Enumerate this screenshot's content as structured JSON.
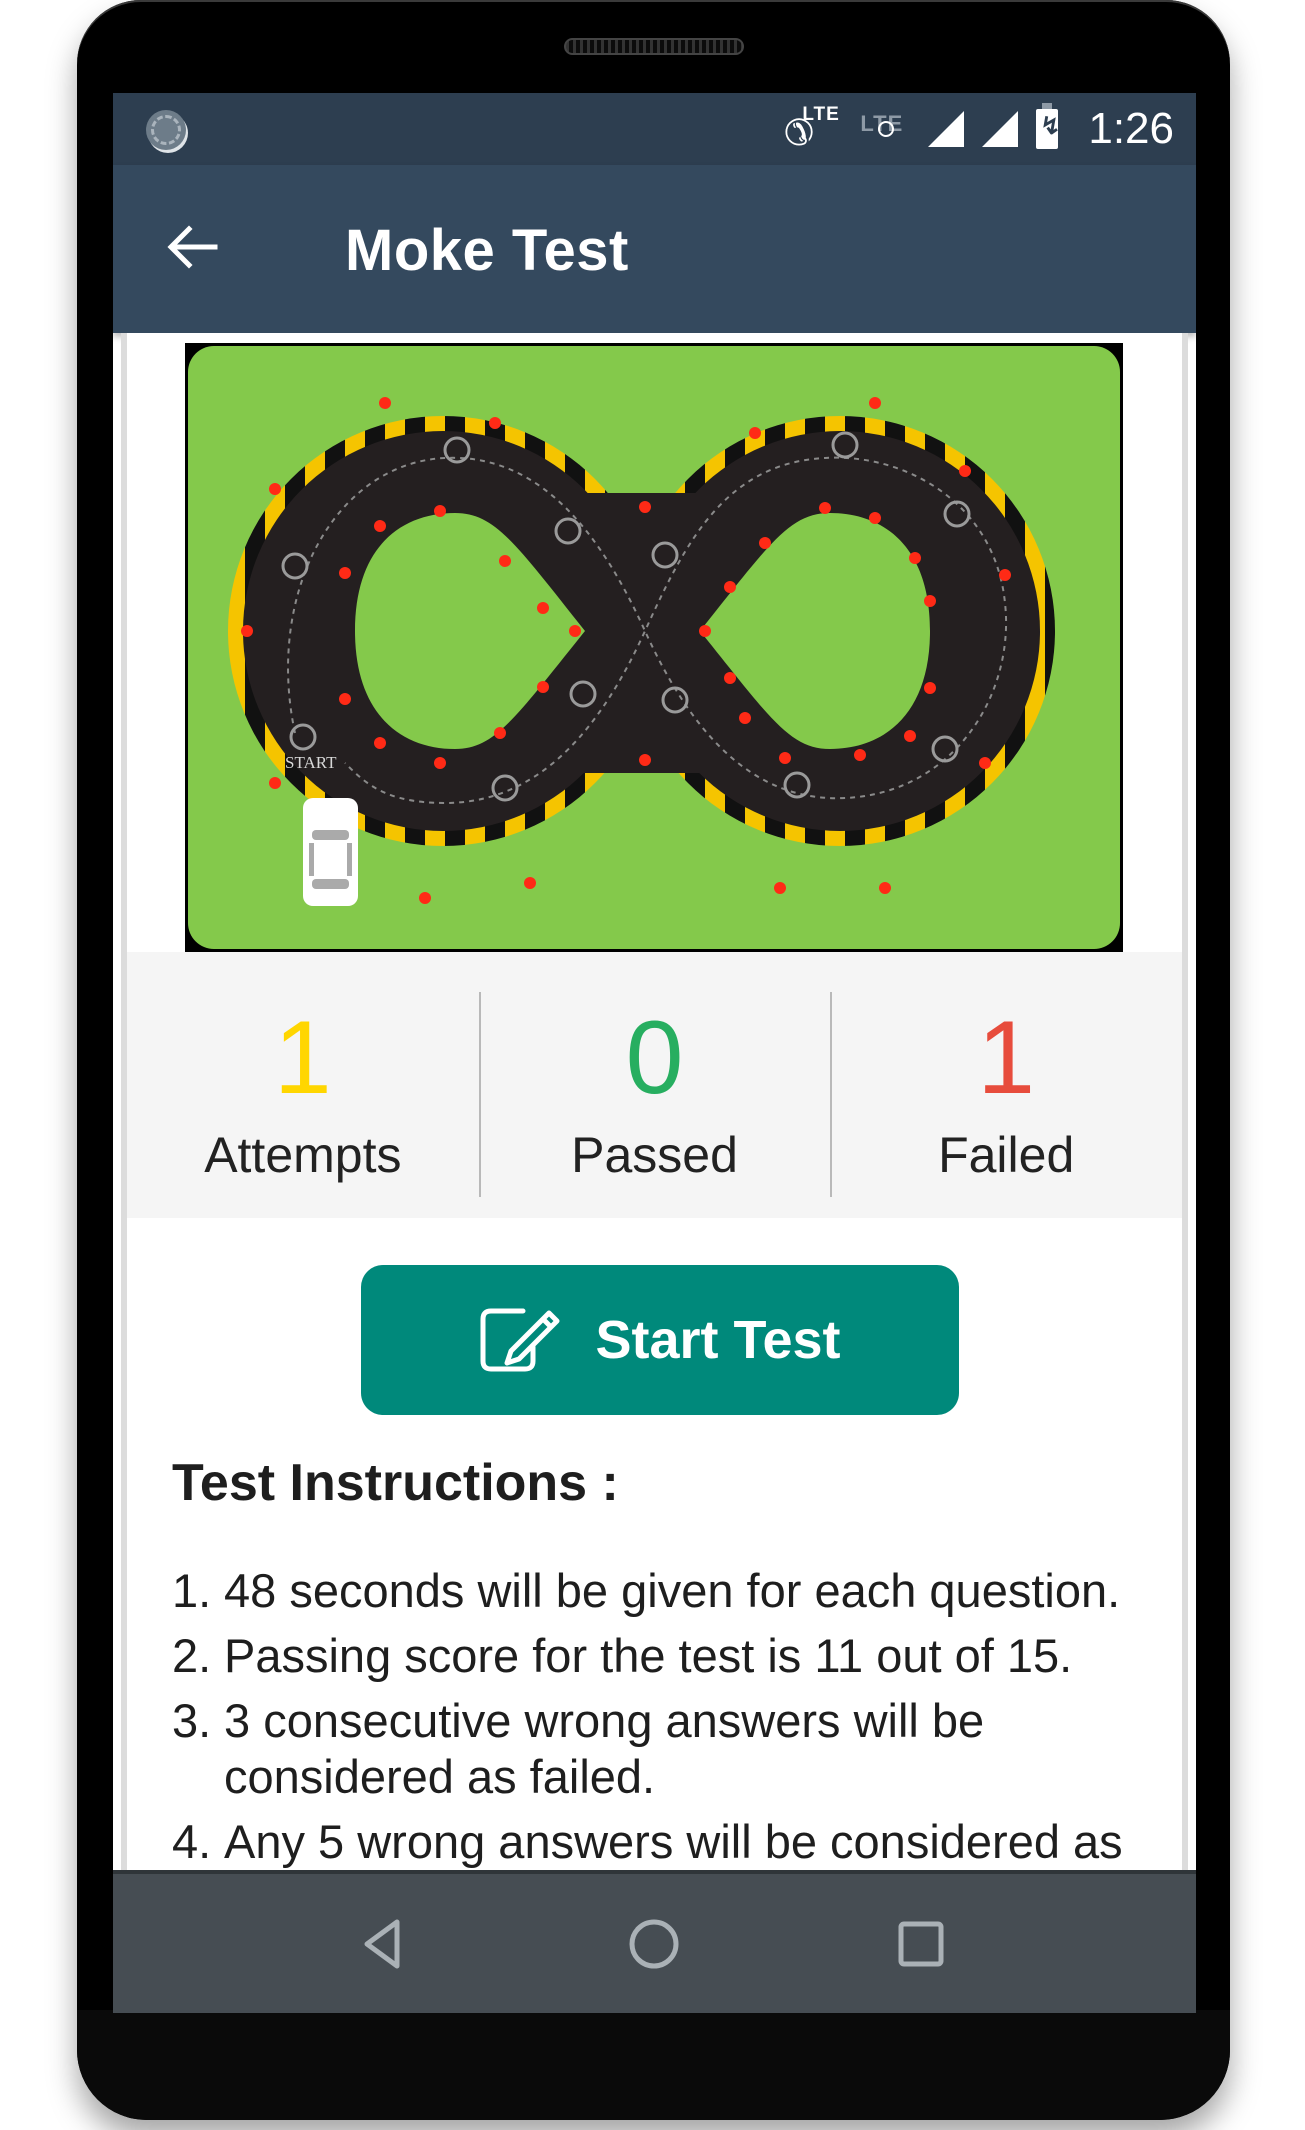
{
  "status_bar": {
    "call_lte_label": "LTE",
    "data_lte_label": "LTE",
    "time": "1:26",
    "icons": [
      "loading-spinner-icon",
      "call-lte-icon",
      "lte-disabled-icon",
      "signal-icon",
      "signal-icon",
      "battery-charging-icon"
    ]
  },
  "app_bar": {
    "back_icon": "arrow-left-icon",
    "title": "Moke Test"
  },
  "track_image": {
    "description": "Figure-eight driving test track",
    "start_label": "START"
  },
  "stats": [
    {
      "value": "1",
      "label": "Attempts",
      "color": "#ffd600"
    },
    {
      "value": "0",
      "label": "Passed",
      "color": "#27ae60"
    },
    {
      "value": "1",
      "label": "Failed",
      "color": "#e74c3c"
    }
  ],
  "start_button": {
    "icon": "edit-pencil-icon",
    "label": "Start Test",
    "color": "#00897b"
  },
  "instructions": {
    "title": "Test Instructions :",
    "items": [
      {
        "num": "1.",
        "text": "48 seconds will be given for each question."
      },
      {
        "num": "2.",
        "text": "Passing score for the test is 11 out of 15."
      },
      {
        "num": "3.",
        "text": "3 consecutive wrong answers will be considered as failed."
      },
      {
        "num": "4.",
        "text": "Any 5 wrong answers will be considered as"
      }
    ]
  },
  "nav_bar": {
    "buttons": [
      "back-triangle-icon",
      "home-circle-icon",
      "recents-square-icon"
    ]
  },
  "colors": {
    "status_bar": "#2d3e50",
    "app_bar": "#34495e",
    "accent": "#00897b",
    "nav_bar": "#464d53"
  }
}
